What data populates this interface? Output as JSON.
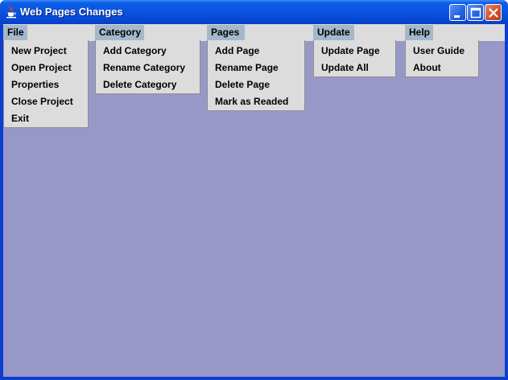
{
  "window": {
    "title": "Web Pages Changes",
    "minimize_icon": "minimize-icon",
    "maximize_icon": "maximize-icon",
    "close_icon": "close-icon"
  },
  "menubar": {
    "menus": [
      {
        "label": "File",
        "items": [
          "New Project",
          "Open Project",
          "Properties",
          "Close Project",
          "Exit"
        ]
      },
      {
        "label": "Category",
        "items": [
          "Add Category",
          "Rename Category",
          "Delete Category"
        ]
      },
      {
        "label": "Pages",
        "items": [
          "Add Page",
          "Rename Page",
          "Delete Page",
          "Mark as Readed"
        ]
      },
      {
        "label": "Update",
        "items": [
          "Update Page",
          "Update All"
        ]
      },
      {
        "label": "Help",
        "items": [
          "User Guide",
          "About"
        ]
      }
    ]
  },
  "colors": {
    "titlebar": "#0a54e0",
    "client_background": "#9898c8",
    "menubar": "#dcdcdc",
    "menu_title_highlight": "#a3b8cc"
  }
}
